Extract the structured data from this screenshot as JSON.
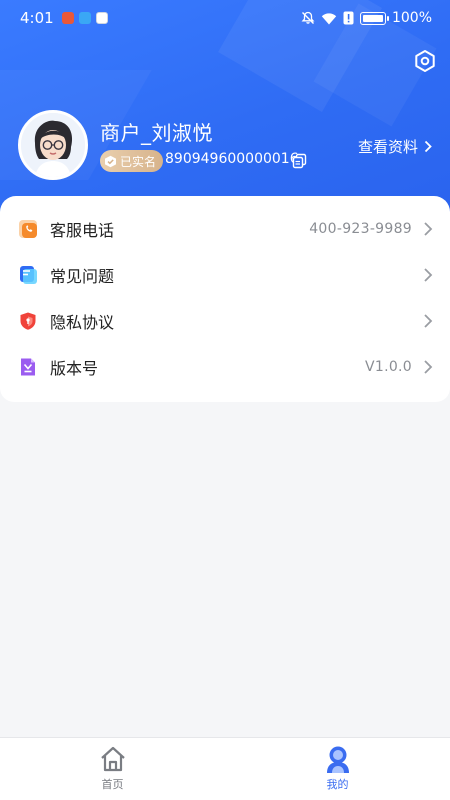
{
  "status_bar": {
    "time": "4:01",
    "battery_text": "100%"
  },
  "profile": {
    "name": "商户_刘淑悦",
    "verify_label": "已实名",
    "merchant_id": "890949600000016",
    "view_profile_label": "查看资料"
  },
  "menu": {
    "items": [
      {
        "label": "客服电话",
        "value": "400-923-9989",
        "icon": "phone-icon",
        "color": "#f58a2b"
      },
      {
        "label": "常见问题",
        "value": "",
        "icon": "faq-icon",
        "color": "#2f6cf4"
      },
      {
        "label": "隐私协议",
        "value": "",
        "icon": "privacy-shield-icon",
        "color": "#f0433a"
      },
      {
        "label": "版本号",
        "value": "V1.0.0",
        "icon": "version-icon",
        "color": "#9b5cf0"
      }
    ]
  },
  "bottom_nav": {
    "home_label": "首页",
    "mine_label": "我的"
  },
  "colors": {
    "header": "#2f6cf4",
    "active_tab": "#3a6cf0",
    "inactive_tab": "#777a80"
  }
}
